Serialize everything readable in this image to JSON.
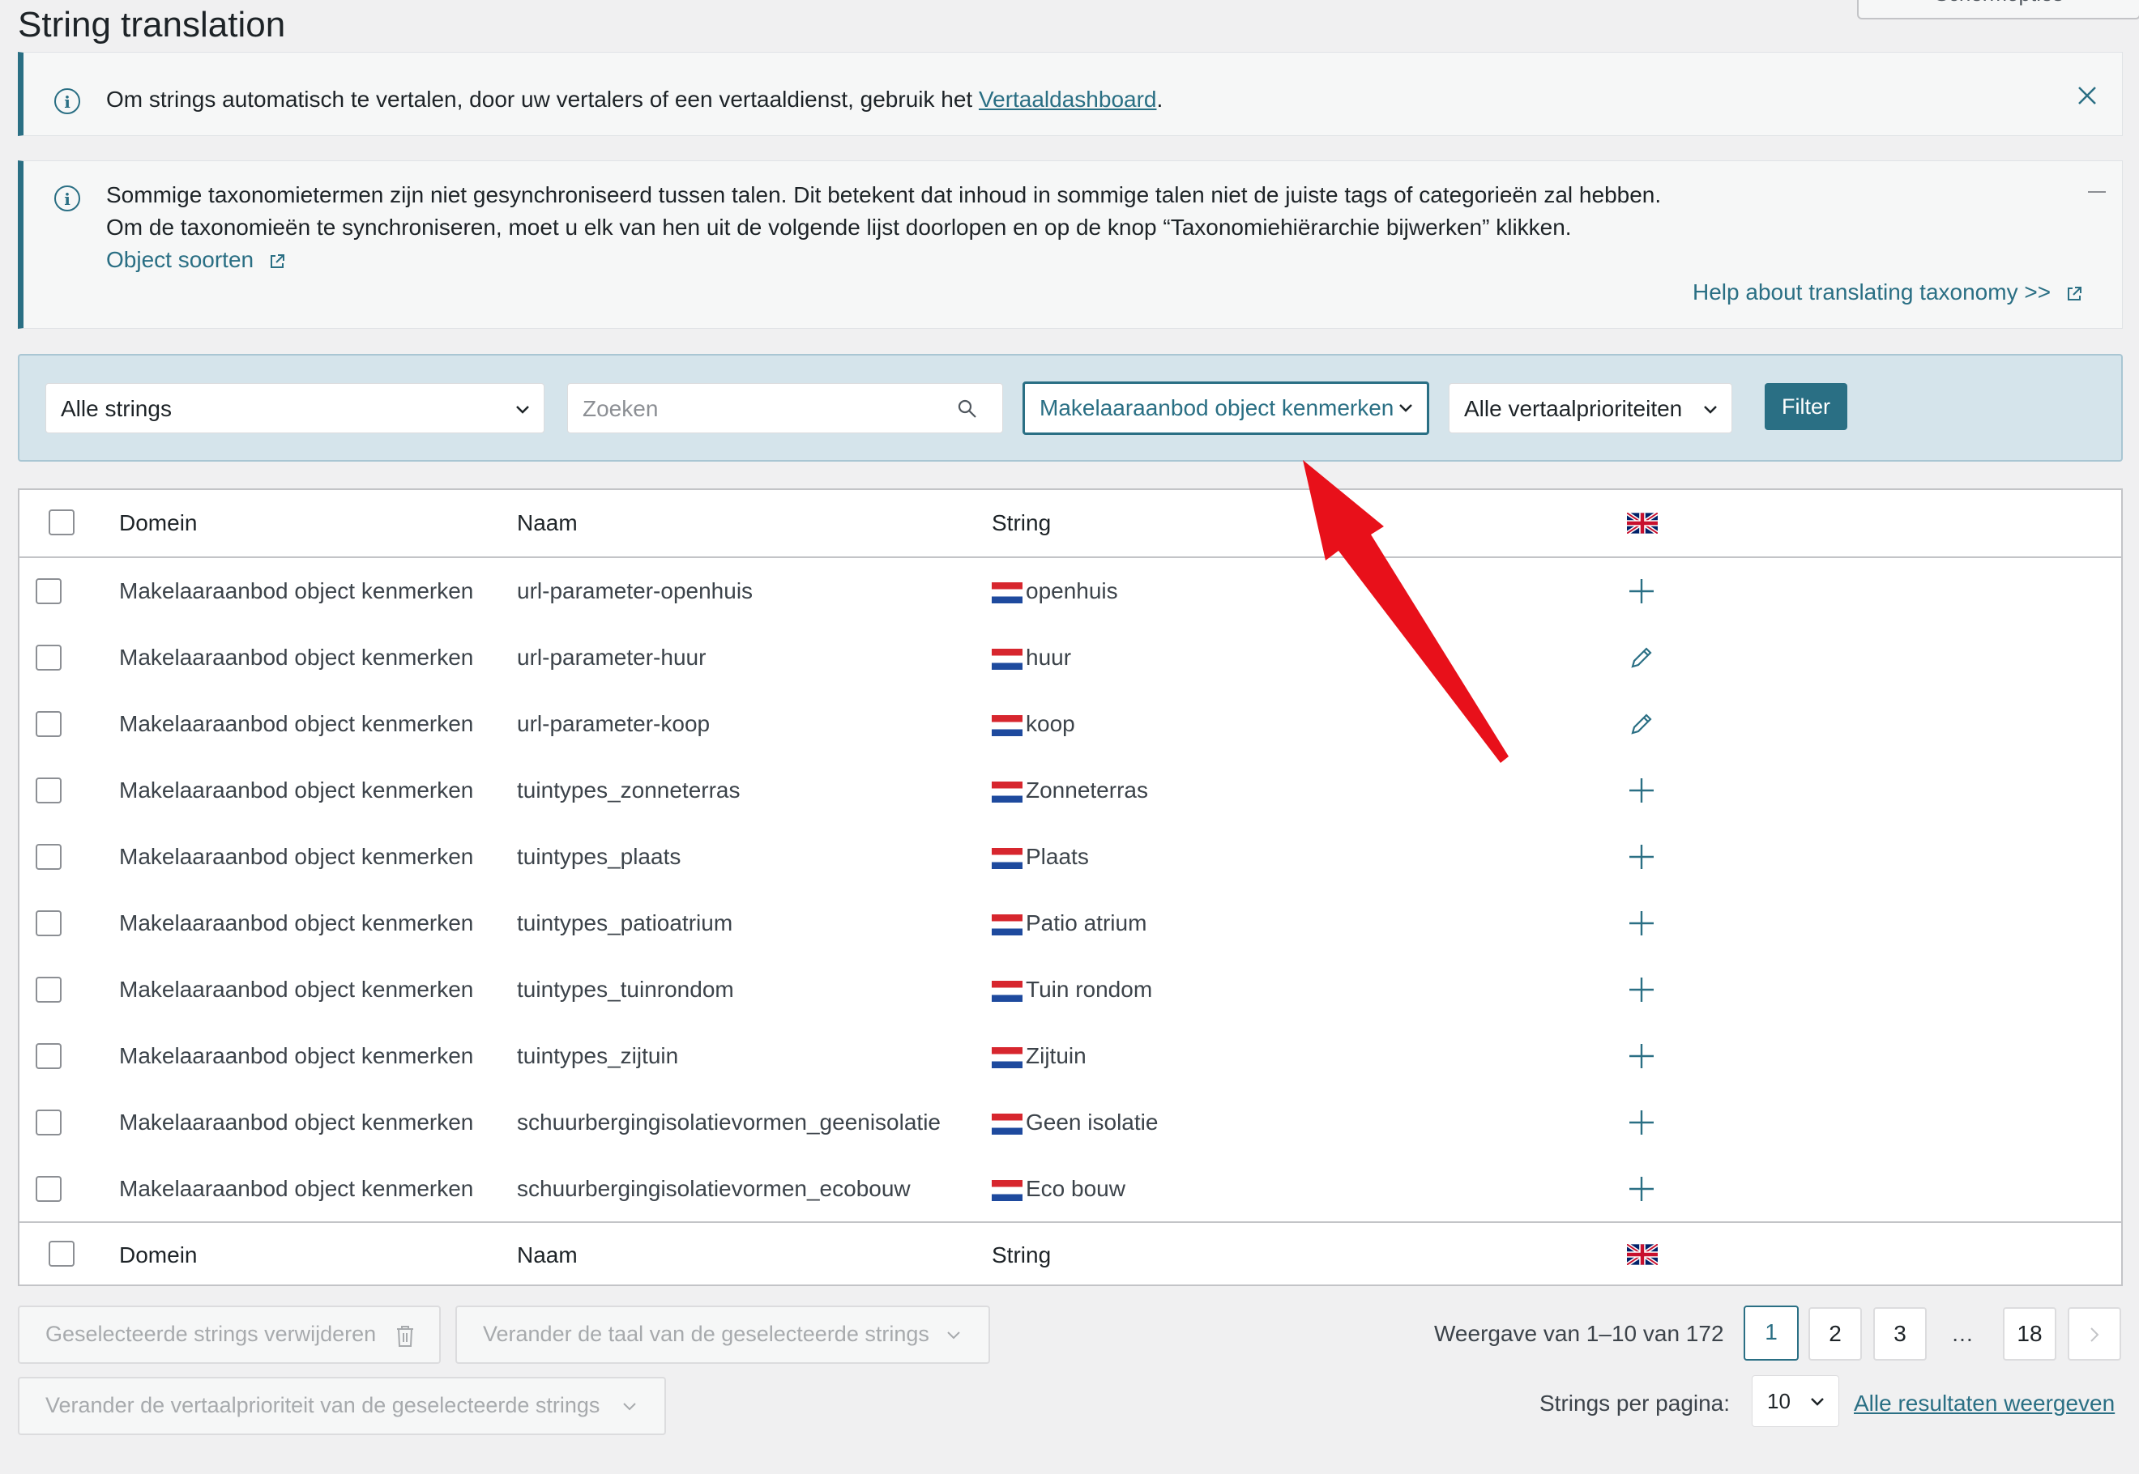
{
  "page": {
    "title": "String translation",
    "screen_options": "Schermopties"
  },
  "notice1": {
    "text": "Om strings automatisch te vertalen, door uw vertalers of een vertaaldienst, gebruik het ",
    "link": "Vertaaldashboard",
    "end": "."
  },
  "notice2": {
    "line1": "Sommige taxonomietermen zijn niet gesynchroniseerd tussen talen. Dit betekent dat inhoud in sommige talen niet de juiste tags of categorieën zal hebben.",
    "line2": "Om de taxonomieën te synchroniseren, moet u elk van hen uit de volgende lijst doorlopen en op de knop “Taxonomiehiërarchie bijwerken” klikken.",
    "link": "Object soorten",
    "help": "Help about translating taxonomy >>"
  },
  "filters": {
    "strings_select": "Alle strings",
    "search_placeholder": "Zoeken",
    "domain_select": "Makelaaraanbod object kenmerken",
    "priority_select": "Alle vertaalprioriteiten",
    "filter_button": "Filter"
  },
  "table": {
    "headers": {
      "domain": "Domein",
      "name": "Naam",
      "string": "String"
    },
    "rows": [
      {
        "domain": "Makelaaraanbod object kenmerken",
        "name": "url-parameter-openhuis",
        "string": "openhuis",
        "action": "add"
      },
      {
        "domain": "Makelaaraanbod object kenmerken",
        "name": "url-parameter-huur",
        "string": "huur",
        "action": "edit"
      },
      {
        "domain": "Makelaaraanbod object kenmerken",
        "name": "url-parameter-koop",
        "string": "koop",
        "action": "edit"
      },
      {
        "domain": "Makelaaraanbod object kenmerken",
        "name": "tuintypes_zonneterras",
        "string": "Zonneterras",
        "action": "add"
      },
      {
        "domain": "Makelaaraanbod object kenmerken",
        "name": "tuintypes_plaats",
        "string": "Plaats",
        "action": "add"
      },
      {
        "domain": "Makelaaraanbod object kenmerken",
        "name": "tuintypes_patioatrium",
        "string": "Patio atrium",
        "action": "add"
      },
      {
        "domain": "Makelaaraanbod object kenmerken",
        "name": "tuintypes_tuinrondom",
        "string": "Tuin rondom",
        "action": "add"
      },
      {
        "domain": "Makelaaraanbod object kenmerken",
        "name": "tuintypes_zijtuin",
        "string": "Zijtuin",
        "action": "add"
      },
      {
        "domain": "Makelaaraanbod object kenmerken",
        "name": "schuurbergingisolatievormen_geenisolatie",
        "string": "Geen isolatie",
        "action": "add"
      },
      {
        "domain": "Makelaaraanbod object kenmerken",
        "name": "schuurbergingisolatievormen_ecobouw",
        "string": "Eco bouw",
        "action": "add"
      }
    ]
  },
  "bulk": {
    "delete": "Geselecteerde strings verwijderen",
    "change_language": "Verander de taal van de geselecteerde strings",
    "change_priority": "Verander de vertaalprioriteit van de geselecteerde strings"
  },
  "pagination": {
    "summary": "Weergave van 1–10 van 172",
    "pages": [
      "1",
      "2",
      "3",
      "…",
      "18"
    ],
    "per_page_label": "Strings per pagina:",
    "per_page_value": "10",
    "show_all": "Alle resultaten weergeven"
  },
  "colors": {
    "accent": "#2a6f84",
    "arrow": "#e8101a"
  }
}
